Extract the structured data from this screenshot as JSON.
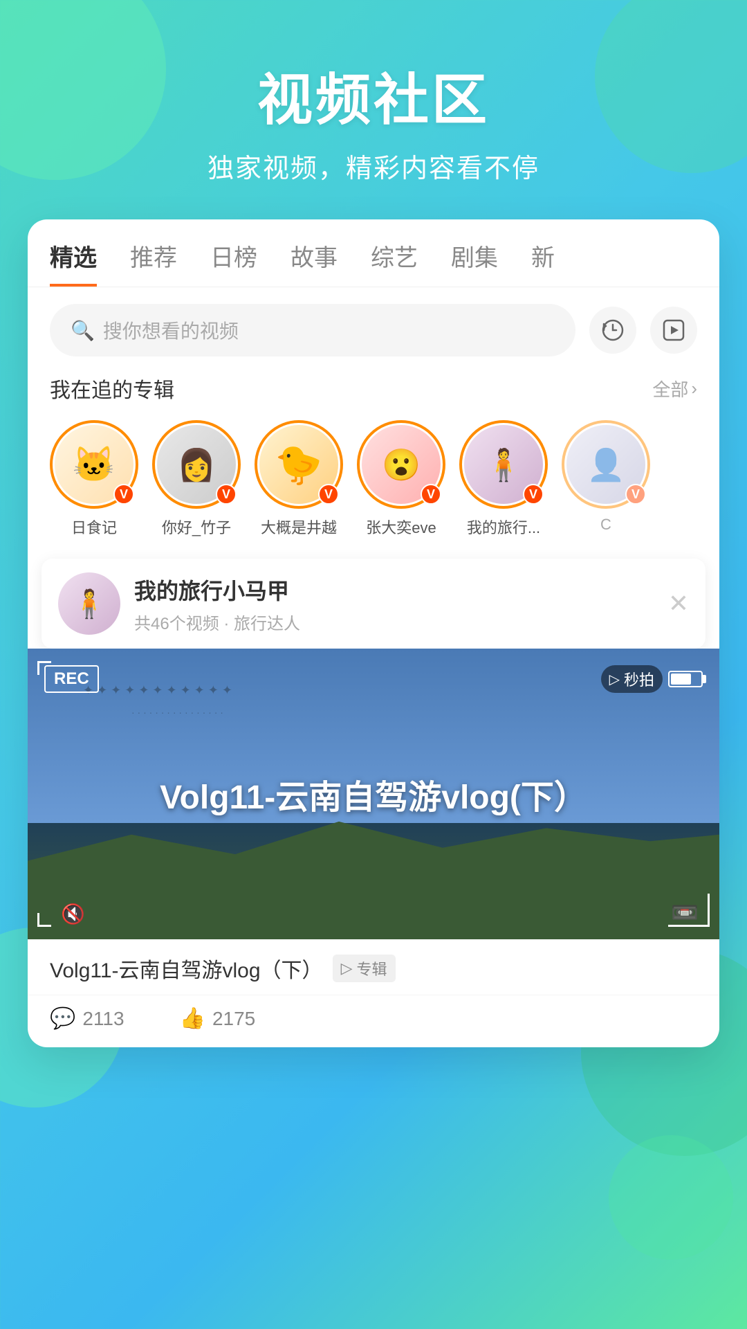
{
  "header": {
    "title": "视频社区",
    "subtitle": "独家视频，精彩内容看不停"
  },
  "tabs": {
    "items": [
      {
        "label": "精选",
        "active": true
      },
      {
        "label": "推荐",
        "active": false
      },
      {
        "label": "日榜",
        "active": false
      },
      {
        "label": "故事",
        "active": false
      },
      {
        "label": "综艺",
        "active": false
      },
      {
        "label": "剧集",
        "active": false
      },
      {
        "label": "新",
        "active": false
      }
    ]
  },
  "search": {
    "placeholder": "搜你想看的视频"
  },
  "following": {
    "title": "我在追的专辑",
    "all_label": "全部",
    "avatars": [
      {
        "name": "日食记",
        "emoji": "🐱"
      },
      {
        "name": "你好_竹子",
        "emoji": "👩"
      },
      {
        "name": "大概是井越",
        "emoji": "🐤"
      },
      {
        "name": "张大奕eve",
        "emoji": "😮"
      },
      {
        "name": "我的旅行...",
        "emoji": "🧍"
      }
    ]
  },
  "popup": {
    "title": "我的旅行小马甲",
    "subtitle": "共46个视频 · 旅行达人",
    "emoji": "🧍"
  },
  "video": {
    "rec_label": "REC",
    "title_overlay": "Volg11-云南自驾游vlog(下）",
    "miao_label": "秒拍",
    "title": "Volg11-云南自驾游vlog（下）",
    "zhuanji_label": "专辑",
    "comments_count": "2113",
    "likes_count": "2175"
  }
}
